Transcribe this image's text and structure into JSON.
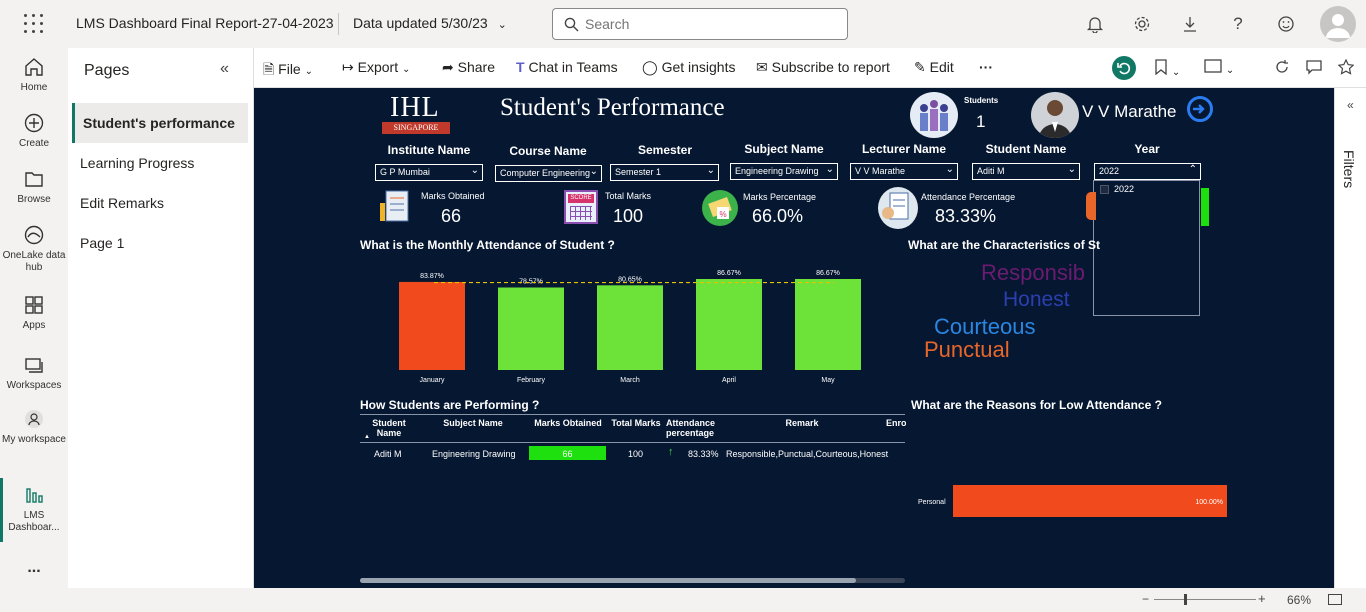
{
  "topbar": {
    "title": "LMS Dashboard Final Report-27-04-2023",
    "data_updated": "Data updated 5/30/23",
    "search_placeholder": "Search"
  },
  "leftnav": {
    "items": [
      {
        "label": "Home"
      },
      {
        "label": "Create"
      },
      {
        "label": "Browse"
      },
      {
        "label": "OneLake data hub"
      },
      {
        "label": "Apps"
      },
      {
        "label": "Workspaces"
      },
      {
        "label": "My workspace"
      },
      {
        "label": "LMS Dashboar..."
      }
    ],
    "more": "..."
  },
  "pages": {
    "title": "Pages",
    "items": [
      "Student's performance",
      "Learning Progress",
      "Edit Remarks",
      "Page 1"
    ]
  },
  "toolbar": {
    "file": "File",
    "export": "Export",
    "share": "Share",
    "chat": "Chat in Teams",
    "insights": "Get insights",
    "subscribe": "Subscribe to report",
    "edit": "Edit",
    "more": "···"
  },
  "report": {
    "logo_text": "IHL",
    "logo_sub": "SINGAPORE",
    "title": "Student's Performance",
    "students_label": "Students",
    "students_value": "1",
    "lecturer": "V V Marathe",
    "slicers": [
      {
        "label": "Institute Name",
        "value": "G P Mumbai"
      },
      {
        "label": "Course Name",
        "value": "Computer Engineering"
      },
      {
        "label": "Semester",
        "value": "Semester 1"
      },
      {
        "label": "Subject Name",
        "value": "Engineering Drawing"
      },
      {
        "label": "Lecturer Name",
        "value": "V V Marathe"
      },
      {
        "label": "Student Name",
        "value": "Aditi M"
      },
      {
        "label": "Year",
        "value": "2022"
      }
    ],
    "year_options": [
      "2022"
    ],
    "kpis": [
      {
        "label": "Marks Obtained",
        "value": "66"
      },
      {
        "label": "Total Marks",
        "value": "100"
      },
      {
        "label": "Marks Percentage",
        "value": "66.0%"
      },
      {
        "label": "Attendance Percentage",
        "value": "83.33%"
      }
    ],
    "kpi_icon_text": "SCORE",
    "attendance_title": "What is the Monthly Attendance of Student ?",
    "characteristics_title": "What are the Characteristics of St",
    "words": [
      {
        "text": "Responsib",
        "color": "#6b1b70"
      },
      {
        "text": "Honest",
        "color": "#2b3fb0"
      },
      {
        "text": "Courteous",
        "color": "#2a86e0"
      },
      {
        "text": "Punctual",
        "color": "#e8662a"
      }
    ],
    "table_title": "How Students are Performing ?",
    "table_headers": [
      "Student Name",
      "Subject Name",
      "Marks Obtained",
      "Total Marks",
      "Attendance percentage",
      "Remark",
      "Enro"
    ],
    "table_rows": [
      {
        "student": "Aditi M",
        "subject": "Engineering Drawing",
        "marks": "66",
        "total": "100",
        "attendance": "83.33%",
        "remark": "Responsible,Punctual,Courteous,Honest"
      }
    ],
    "reasons_title": "What are the Reasons for Low Attendance ?"
  },
  "chart_data": [
    {
      "type": "bar",
      "title": "What is the Monthly Attendance of Student ?",
      "categories": [
        "January",
        "February",
        "March",
        "April",
        "May"
      ],
      "values": [
        83.87,
        78.57,
        80.65,
        86.67,
        86.67
      ],
      "labels": [
        "83.87%",
        "78.57%",
        "80.65%",
        "86.67%",
        "86.67%"
      ],
      "colors": [
        "#f04a1d",
        "#6de33a",
        "#6de33a",
        "#6de33a",
        "#6de33a"
      ],
      "reference_line": "dashed yellow average",
      "ylim": [
        0,
        100
      ],
      "grid": false
    },
    {
      "type": "bar",
      "orientation": "horizontal",
      "title": "What are the Reasons for Low Attendance ?",
      "categories": [
        "Personal"
      ],
      "values": [
        100.0
      ],
      "labels": [
        "100.00%"
      ],
      "colors": [
        "#f04a1d"
      ]
    }
  ],
  "statusbar": {
    "zoom": "66%"
  },
  "filters_label": "Filters",
  "colors": {
    "canvas": "#061731",
    "accent_green": "#6de33a",
    "accent_orange": "#f04a1d",
    "teal": "#117865"
  }
}
